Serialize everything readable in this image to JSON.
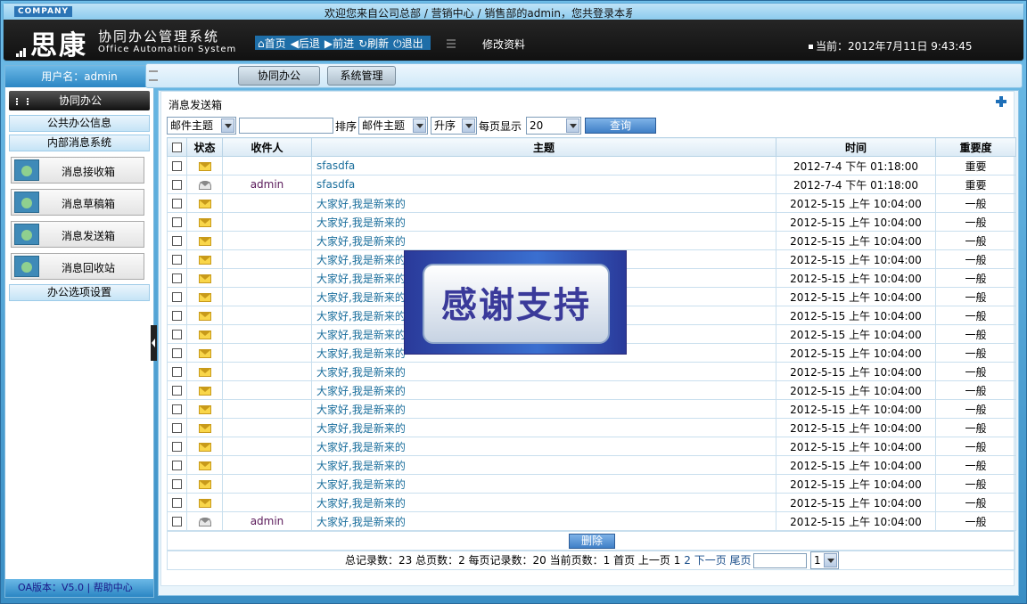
{
  "header": {
    "company_badge": "COMPANY",
    "welcome": "欢迎您来自公司总部 / 营销中心 / 销售部的admin，您共登录本系",
    "logo": "思康",
    "system_name_cn": "协同办公管理系统",
    "system_name_en": "Office Automation System",
    "nav": [
      {
        "label": "⌂首页",
        "icon": "home-icon"
      },
      {
        "label": "◀后退",
        "icon": "back-icon"
      },
      {
        "label": "▶前进",
        "icon": "forward-icon"
      },
      {
        "label": "↻刷新",
        "icon": "refresh-icon"
      },
      {
        "label": "⏻退出",
        "icon": "power-icon"
      }
    ],
    "profile_link": "修改资料",
    "datetime": "当前：2012年7月11日  9:43:45"
  },
  "sidebar": {
    "user": "用户名：admin",
    "section_title": "协同办公",
    "groups": [
      "公共办公信息",
      "内部消息系统",
      "办公选项设置"
    ],
    "items": [
      "消息接收箱",
      "消息草稿箱",
      "消息发送箱",
      "消息回收站"
    ],
    "version": "OA版本：V5.0 | 帮助中心"
  },
  "tabs": [
    "协同办公",
    "系统管理"
  ],
  "panel": {
    "title": "消息发送箱"
  },
  "filter": {
    "field_select": "邮件主题",
    "search_value": "",
    "sort_label": "排序",
    "sort_field": "邮件主题",
    "sort_order": "升序",
    "page_size_label": "每页显示",
    "page_size": "20",
    "query_button": "查询"
  },
  "table": {
    "headers": [
      "状态",
      "收件人",
      "主题",
      "时间",
      "重要度"
    ],
    "rows": [
      {
        "status": "unread",
        "recipient": "",
        "subject": "sfasdfa",
        "time": "2012-7-4 下午  01:18:00",
        "importance": "重要"
      },
      {
        "status": "read",
        "recipient": "admin",
        "subject": "sfasdfa",
        "time": "2012-7-4 下午  01:18:00",
        "importance": "重要"
      },
      {
        "status": "unread",
        "recipient": "",
        "subject": "大家好,我是新来的",
        "time": "2012-5-15 上午  10:04:00",
        "importance": "一般"
      },
      {
        "status": "unread",
        "recipient": "",
        "subject": "大家好,我是新来的",
        "time": "2012-5-15 上午  10:04:00",
        "importance": "一般"
      },
      {
        "status": "unread",
        "recipient": "",
        "subject": "大家好,我是新来的",
        "time": "2012-5-15 上午  10:04:00",
        "importance": "一般"
      },
      {
        "status": "unread",
        "recipient": "",
        "subject": "大家好,我是新来的",
        "time": "2012-5-15 上午  10:04:00",
        "importance": "一般"
      },
      {
        "status": "unread",
        "recipient": "",
        "subject": "大家好,我是新来的",
        "time": "2012-5-15 上午  10:04:00",
        "importance": "一般"
      },
      {
        "status": "unread",
        "recipient": "",
        "subject": "大家好,我是新来的",
        "time": "2012-5-15 上午  10:04:00",
        "importance": "一般"
      },
      {
        "status": "unread",
        "recipient": "",
        "subject": "大家好,我是新来的",
        "time": "2012-5-15 上午  10:04:00",
        "importance": "一般"
      },
      {
        "status": "unread",
        "recipient": "",
        "subject": "大家好,我是新来的",
        "time": "2012-5-15 上午  10:04:00",
        "importance": "一般"
      },
      {
        "status": "unread",
        "recipient": "",
        "subject": "大家好,我是新来的",
        "time": "2012-5-15 上午  10:04:00",
        "importance": "一般"
      },
      {
        "status": "unread",
        "recipient": "",
        "subject": "大家好,我是新来的",
        "time": "2012-5-15 上午  10:04:00",
        "importance": "一般"
      },
      {
        "status": "unread",
        "recipient": "",
        "subject": "大家好,我是新来的",
        "time": "2012-5-15 上午  10:04:00",
        "importance": "一般"
      },
      {
        "status": "unread",
        "recipient": "",
        "subject": "大家好,我是新来的",
        "time": "2012-5-15 上午  10:04:00",
        "importance": "一般"
      },
      {
        "status": "unread",
        "recipient": "",
        "subject": "大家好,我是新来的",
        "time": "2012-5-15 上午  10:04:00",
        "importance": "一般"
      },
      {
        "status": "unread",
        "recipient": "",
        "subject": "大家好,我是新来的",
        "time": "2012-5-15 上午  10:04:00",
        "importance": "一般"
      },
      {
        "status": "unread",
        "recipient": "",
        "subject": "大家好,我是新来的",
        "time": "2012-5-15 上午  10:04:00",
        "importance": "一般"
      },
      {
        "status": "unread",
        "recipient": "",
        "subject": "大家好,我是新来的",
        "time": "2012-5-15 上午  10:04:00",
        "importance": "一般"
      },
      {
        "status": "unread",
        "recipient": "",
        "subject": "大家好,我是新来的",
        "time": "2012-5-15 上午  10:04:00",
        "importance": "一般"
      },
      {
        "status": "read",
        "recipient": "admin",
        "subject": "大家好,我是新来的",
        "time": "2012-5-15 上午  10:04:00",
        "importance": "一般"
      }
    ]
  },
  "delete_button": "删除",
  "pager": {
    "summary": "总记录数：23 总页数：2 每页记录数：20 当前页数：1 ",
    "first": "首页",
    "prev": "上一页",
    "page_current": "1",
    "page_2": "2",
    "next": "下一页",
    "last": "尾页",
    "goto_value": "",
    "page_select": "1"
  },
  "overlay": {
    "text": "感谢支持"
  },
  "colors": {
    "accent": "#2b86c4",
    "header_bg": "#1a1a1a",
    "link": "#1a6e9c"
  }
}
